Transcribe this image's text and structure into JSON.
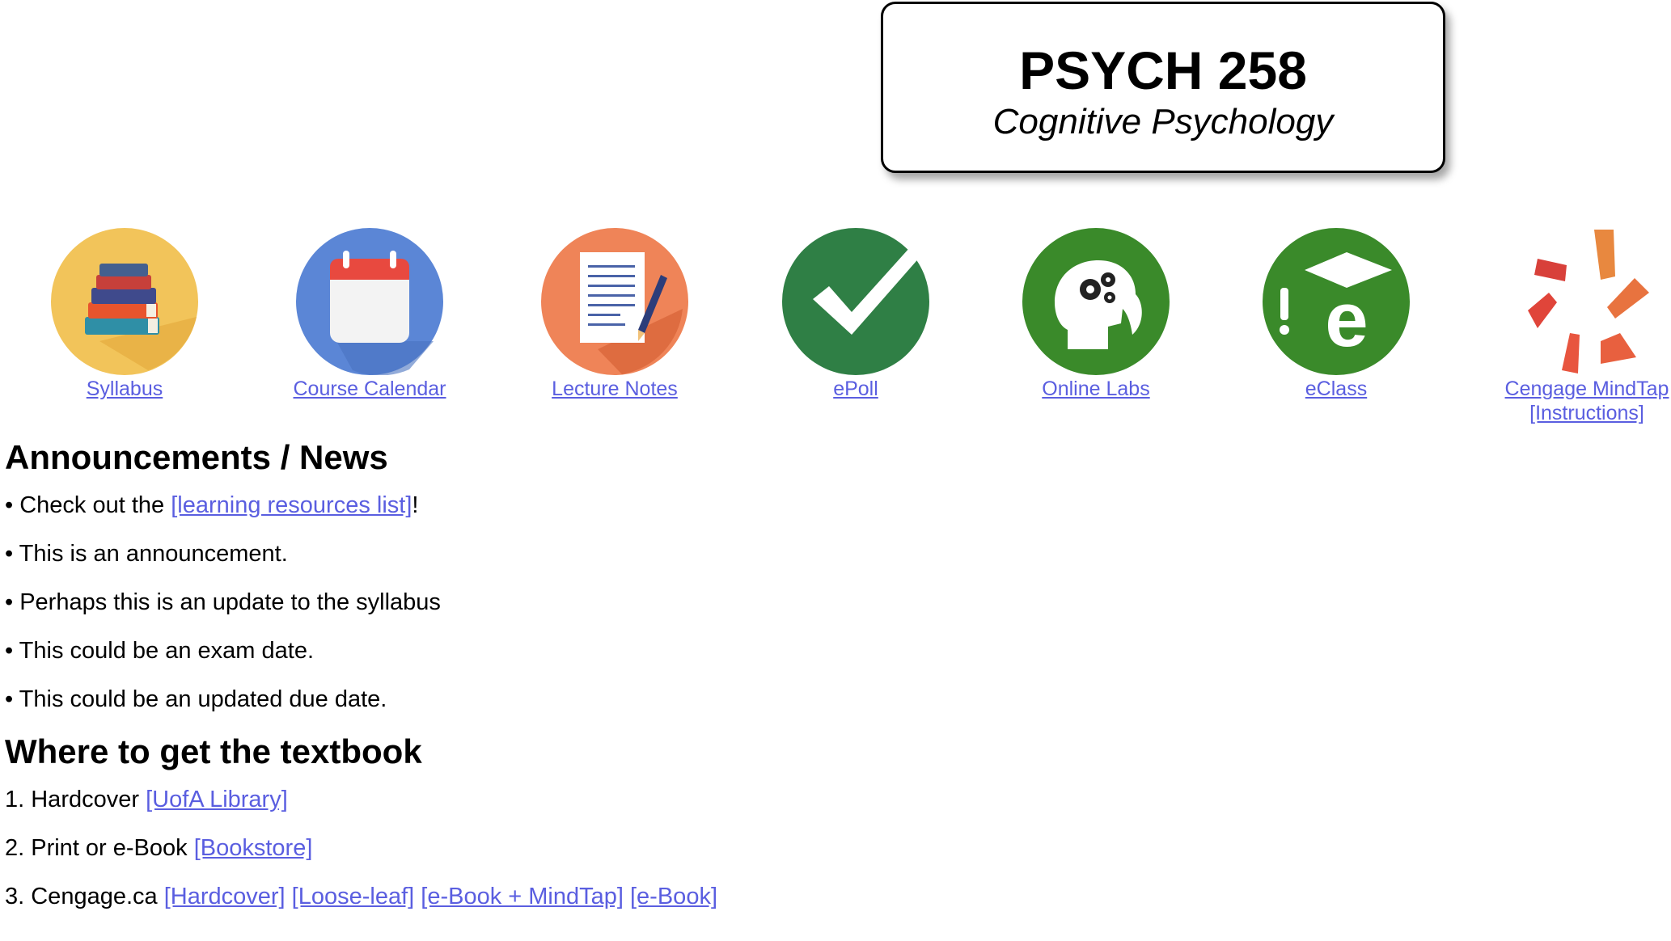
{
  "header": {
    "course_code": "PSYCH 258",
    "course_name": "Cognitive Psychology"
  },
  "nav": [
    {
      "label": "Syllabus",
      "icon": "books-icon",
      "color": "#f2c45a"
    },
    {
      "label": "Course Calendar",
      "icon": "calendar-icon",
      "color": "#5b86d6"
    },
    {
      "label": "Lecture Notes",
      "icon": "notes-icon",
      "color": "#ef8458"
    },
    {
      "label": "ePoll",
      "icon": "checkmark-icon",
      "color": "#2f7f45"
    },
    {
      "label": "Online Labs",
      "icon": "brain-gears-icon",
      "color": "#3a8a2a"
    },
    {
      "label": "eClass",
      "icon": "eclass-icon",
      "color": "#3a8a2a"
    },
    {
      "label": "Cengage MindTap",
      "sublabel": "[Instructions]",
      "icon": "cengage-logo-icon",
      "color": "#e8653f"
    }
  ],
  "announcements": {
    "heading": "Announcements / News",
    "items": [
      {
        "prefix": "• Check out the ",
        "link": "[learning resources list]",
        "suffix": "!"
      },
      {
        "text": "• This is an announcement."
      },
      {
        "text": "• Perhaps this is an update to the syllabus"
      },
      {
        "text": "• This could be an exam date."
      },
      {
        "text": "• This could be an updated due date."
      }
    ]
  },
  "textbook": {
    "heading": "Where to get the textbook",
    "items": [
      {
        "prefix": "1. Hardcover ",
        "links": [
          "[UofA Library]"
        ]
      },
      {
        "prefix": "2. Print or e-Book ",
        "links": [
          "[Bookstore]"
        ]
      },
      {
        "prefix": "3. Cengage.ca ",
        "links": [
          "[Hardcover]",
          "[Loose-leaf]",
          "[e-Book + MindTap]",
          "[e-Book]"
        ]
      }
    ]
  }
}
